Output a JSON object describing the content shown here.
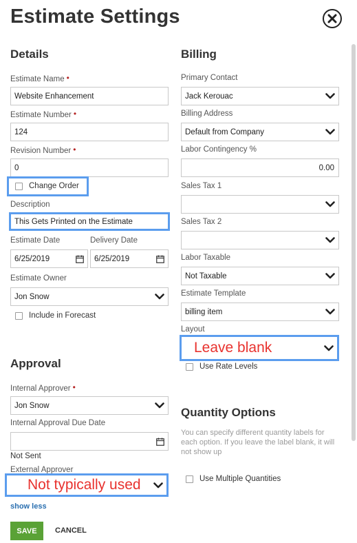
{
  "title": "Estimate Settings",
  "details": {
    "heading": "Details",
    "estimate_name": {
      "label": "Estimate Name",
      "value": "Website Enhancement"
    },
    "estimate_number": {
      "label": "Estimate Number",
      "value": "124"
    },
    "revision_number": {
      "label": "Revision Number",
      "value": "0"
    },
    "change_order": {
      "label": "Change Order",
      "checked": false
    },
    "description": {
      "label": "Description",
      "value": "This Gets Printed on the Estimate"
    },
    "estimate_date": {
      "label": "Estimate Date",
      "value": "6/25/2019"
    },
    "delivery_date": {
      "label": "Delivery Date",
      "value": "6/25/2019"
    },
    "estimate_owner": {
      "label": "Estimate Owner",
      "value": "Jon Snow"
    },
    "include_forecast": {
      "label": "Include in Forecast",
      "checked": false
    }
  },
  "approval": {
    "heading": "Approval",
    "internal_approver": {
      "label": "Internal Approver",
      "value": "Jon Snow"
    },
    "due_date": {
      "label": "Internal Approval Due Date",
      "value": ""
    },
    "status": "Not Sent",
    "external_approver": {
      "label": "External Approver",
      "annotation": "Not typically used"
    },
    "show_less": "show less"
  },
  "billing": {
    "heading": "Billing",
    "primary_contact": {
      "label": "Primary Contact",
      "value": "Jack Kerouac"
    },
    "billing_address": {
      "label": "Billing Address",
      "value": "Default from Company"
    },
    "labor_contingency": {
      "label": "Labor Contingency %",
      "value": "0.00"
    },
    "sales_tax_1": {
      "label": "Sales Tax 1",
      "value": ""
    },
    "sales_tax_2": {
      "label": "Sales Tax 2",
      "value": ""
    },
    "labor_taxable": {
      "label": "Labor Taxable",
      "value": "Not Taxable"
    },
    "estimate_template": {
      "label": "Estimate Template",
      "value": "billing item"
    },
    "layout": {
      "label": "Layout",
      "annotation": "Leave blank"
    },
    "use_rate_levels": {
      "label": "Use Rate Levels",
      "checked": false
    }
  },
  "quantity": {
    "heading": "Quantity Options",
    "help": "You can specify different quantity labels for each option. If you leave the label blank, it will not show up",
    "use_multiple": {
      "label": "Use Multiple Quantities",
      "checked": false
    }
  },
  "footer": {
    "save": "SAVE",
    "cancel": "CANCEL"
  },
  "colors": {
    "save": "#5aa236",
    "highlight": "#5b9dee",
    "annotation": "#e8322e",
    "required": "#b52323",
    "link": "#2a6fb0"
  },
  "icons": [
    "close-icon",
    "chevron-down-icon",
    "calendar-icon",
    "checkbox-icon"
  ]
}
